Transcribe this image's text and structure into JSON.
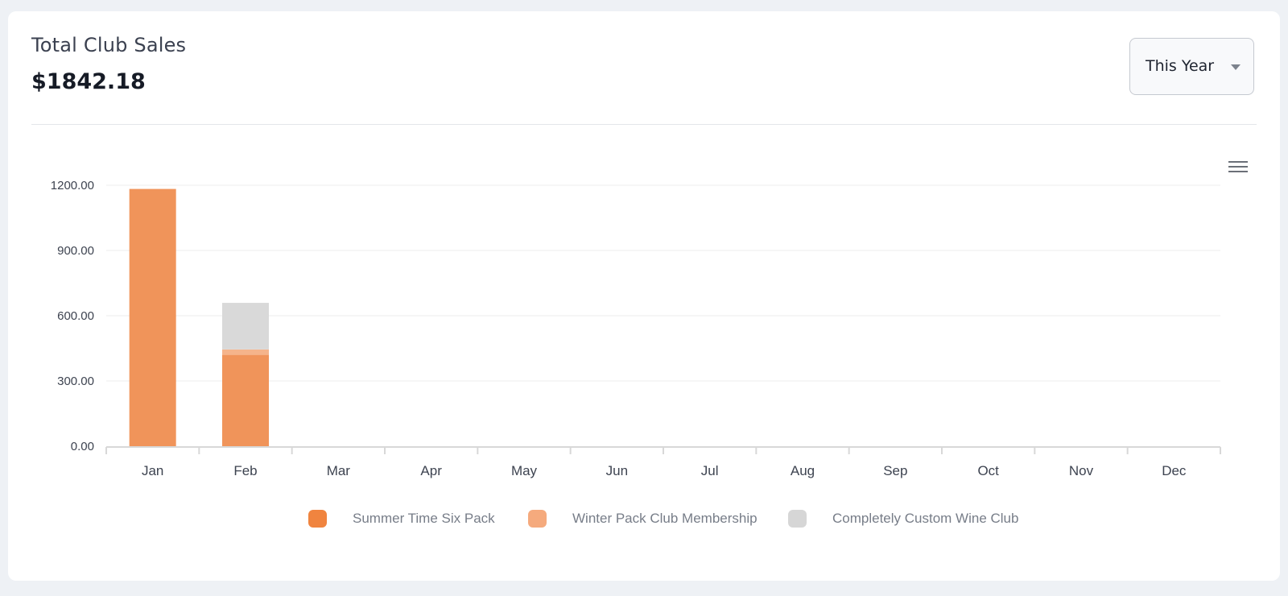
{
  "header": {
    "title": "Total Club Sales",
    "total": "$1842.18",
    "period_label": "This Year",
    "menu_icon": "hamburger-menu-icon",
    "caret_icon": "caret-down-icon"
  },
  "chart_data": {
    "type": "bar",
    "stacked": true,
    "categories": [
      "Jan",
      "Feb",
      "Mar",
      "Apr",
      "May",
      "Jun",
      "Jul",
      "Aug",
      "Sep",
      "Oct",
      "Nov",
      "Dec"
    ],
    "series": [
      {
        "name": "Summer Time Six Pack",
        "color": "#f0945a",
        "values": [
          1183,
          420,
          0,
          0,
          0,
          0,
          0,
          0,
          0,
          0,
          0,
          0
        ]
      },
      {
        "name": "Winter Pack Club Membership",
        "color": "#f5b48b",
        "values": [
          0,
          25,
          0,
          0,
          0,
          0,
          0,
          0,
          0,
          0,
          0,
          0
        ]
      },
      {
        "name": "Completely Custom Wine Club",
        "color": "#d9d9d9",
        "values": [
          0,
          214.18,
          0,
          0,
          0,
          0,
          0,
          0,
          0,
          0,
          0,
          0
        ]
      }
    ],
    "yticks": [
      "0.00",
      "300.00",
      "600.00",
      "900.00",
      "1200.00"
    ],
    "ylim": [
      0,
      1200
    ],
    "grid": true,
    "legend_position": "bottom"
  }
}
